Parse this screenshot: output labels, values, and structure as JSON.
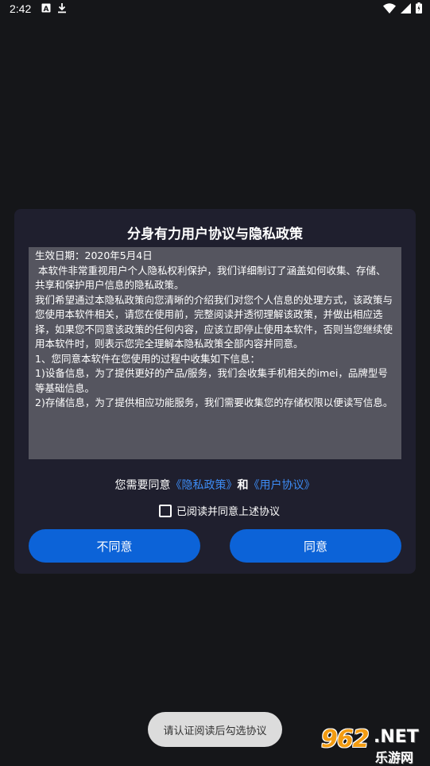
{
  "status_bar": {
    "time": "2:42",
    "icons_left": [
      "font-a-icon",
      "download-icon"
    ],
    "icons_right": [
      "wifi-icon",
      "signal-icon",
      "battery-icon"
    ]
  },
  "dialog": {
    "title": "分身有力用户协议与隐私政策",
    "policy_lines": [
      "生效日期：2020年5月4日",
      " 本软件非常重视用户个人隐私权利保护，我们详细制订了涵盖如何收集、存储、",
      "共享和保护用户信息的隐私政策。",
      "",
      "我们希望通过本隐私政策向您清晰的介绍我们对您个人信息的处理方式，该政策与",
      "您使用本软件相关，请您在使用前，完整阅读并透彻理解该政策，并做出相应选",
      "择，如果您不同意该政策的任何内容，应该立即停止使用本软件，否则当您继续使",
      "用本软件时，则表示您完全理解本隐私政策全部内容并同意。",
      "",
      "1、您同意本软件在您使用的过程中收集如下信息：",
      "",
      "1)设备信息，为了提供更好的产品/服务，我们会收集手机相关的imei，品牌型号",
      "等基础信息。",
      "",
      "2)存储信息，为了提供相应功能服务，我们需要收集您的存储权限以便读写信息。"
    ],
    "agree_prefix": "您需要同意",
    "privacy_link": "《隐私政策》",
    "and_text": "和",
    "terms_link": "《用户协议》",
    "checkbox_label": "已阅读并同意上述协议",
    "checkbox_checked": false,
    "disagree_button": "不同意",
    "agree_button": "同意"
  },
  "toast": {
    "text": "请认证阅读后勾选协议"
  },
  "watermark": {
    "number": "962",
    "domain": ".NET",
    "name": "乐游网"
  },
  "colors": {
    "background": "#151619",
    "dialog": "#1f1f2e",
    "policy_box": "#55555f",
    "button": "#0c63d8",
    "link": "#3d8cf5",
    "toast": "#dcdcdc"
  }
}
